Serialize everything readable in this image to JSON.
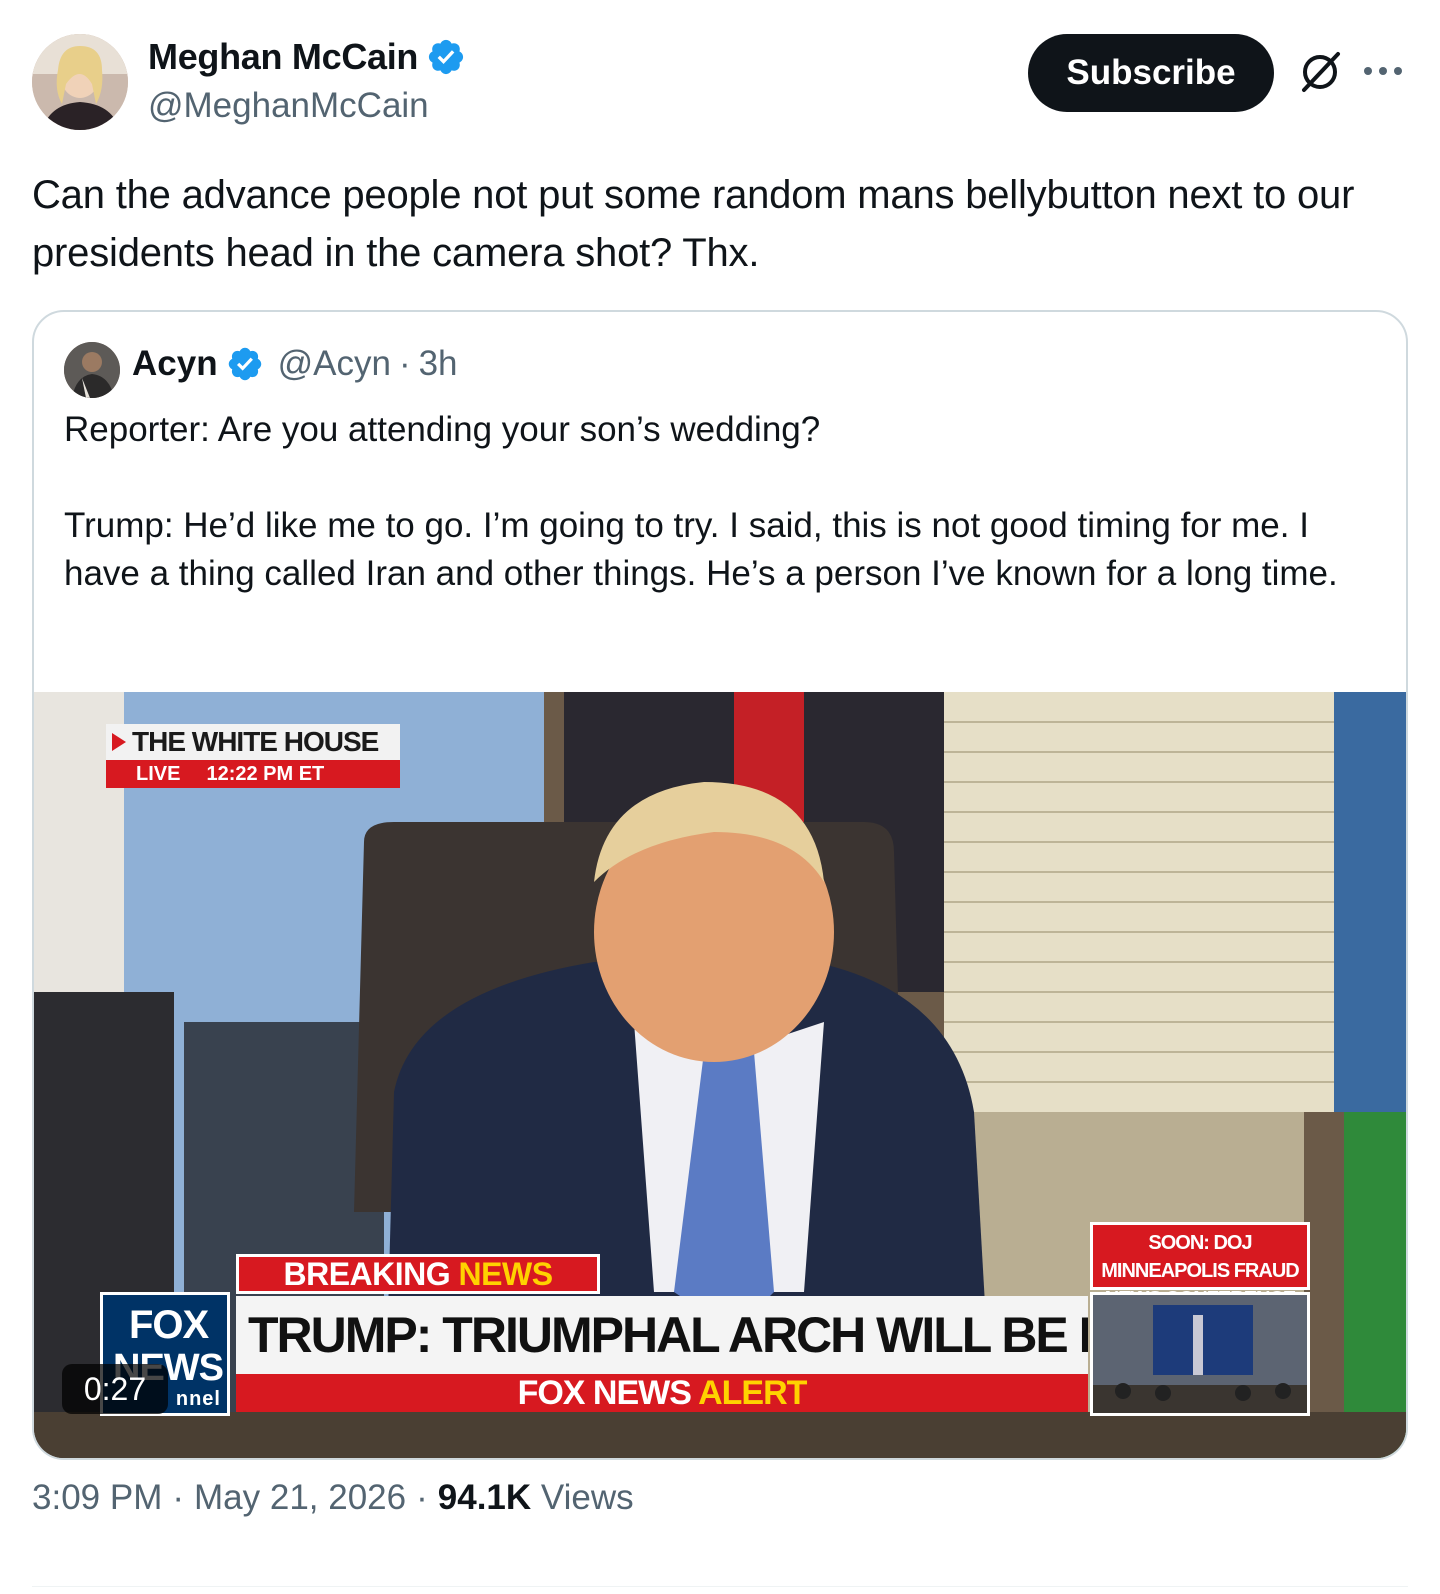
{
  "author": {
    "display_name": "Meghan McCain",
    "handle": "@MeghanMcCain"
  },
  "header": {
    "subscribe_label": "Subscribe",
    "grok_icon": "grok-icon",
    "more_icon": "more-icon"
  },
  "tweet": {
    "text": "Can the advance people not put some random mans bellybutton next to our presidents head in the camera shot? Thx."
  },
  "quote": {
    "display_name": "Acyn",
    "handle": "@Acyn",
    "separator": "·",
    "time": "3h",
    "text": "Reporter: Are you attending your son’s wedding?\n\nTrump: He’d like me to go. I’m going to try. I said, this is not good timing for me. I have a thing called Iran and other things. He’s a person I’ve known for a long time."
  },
  "video": {
    "duration": "0:27",
    "overlay": {
      "location": "THE WHITE HOUSE",
      "live_label": "LIVE",
      "live_time": "12:22 PM ET",
      "breaking_prefix": "BREAKING",
      "breaking_accent": "NEWS",
      "headline": "TRUMP: TRIUMPHAL ARCH WILL BE BEAUTIFUL",
      "alert_prefix": "FOX NEWS",
      "alert_accent": "ALERT",
      "logo_line1": "FOX",
      "logo_line2": "NEWS",
      "logo_line3": "nnel",
      "soon_text": "SOON: DOJ MINNEAPOLIS FRAUD NEWS CONFERENCE"
    },
    "colors": {
      "fox_red": "#d71920",
      "fox_blue": "#003366",
      "accent_yellow": "#ffd200"
    }
  },
  "footer": {
    "time": "3:09 PM",
    "separator": "·",
    "date": "May 21, 2026",
    "views_count": "94.1K",
    "views_label": "Views"
  },
  "colors": {
    "text_primary": "#0f1419",
    "text_secondary": "#536471",
    "verified_blue": "#1d9bf0",
    "border": "#cfd9de"
  }
}
